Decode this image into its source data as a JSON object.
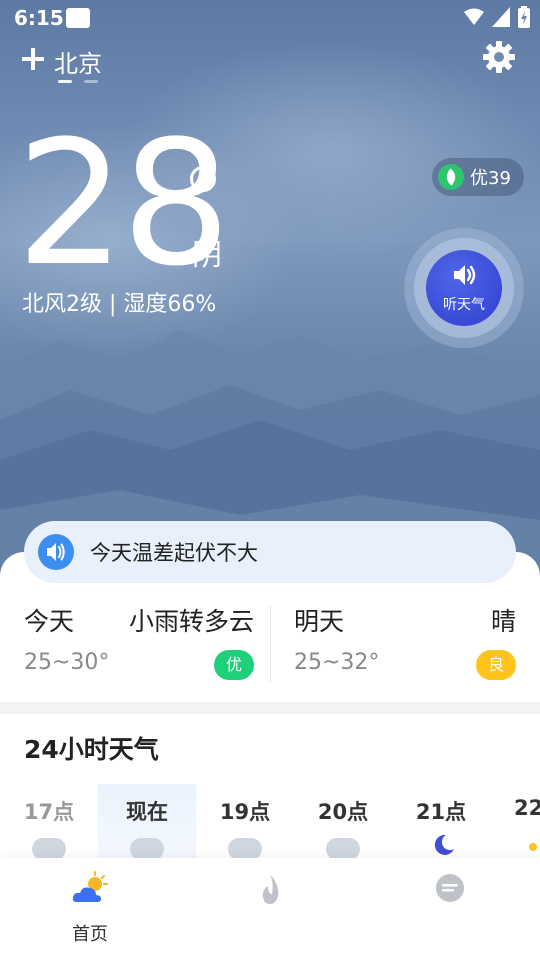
{
  "status_bar": {
    "time": "6:15"
  },
  "header": {
    "city": "北京"
  },
  "current": {
    "temperature": "28",
    "condition": "阴",
    "wind_humidity": "北风2级 | 湿度66%"
  },
  "aqi": {
    "label": "优39",
    "color": "#2fc46e"
  },
  "listen": {
    "label": "听天气"
  },
  "tip": {
    "text": "今天温差起伏不大"
  },
  "forecast": [
    {
      "day": "今天",
      "condition": "小雨转多云",
      "range": "25~30°",
      "quality": "优",
      "quality_color": "#1ed07a"
    },
    {
      "day": "明天",
      "condition": "晴",
      "range": "25~32°",
      "quality": "良",
      "quality_color": "#ffc31a"
    }
  ],
  "hourly": {
    "title": "24小时天气",
    "hours": [
      "17点",
      "现在",
      "19点",
      "20点",
      "21点",
      "22"
    ]
  },
  "nav": {
    "items": [
      {
        "label": "首页"
      }
    ]
  }
}
